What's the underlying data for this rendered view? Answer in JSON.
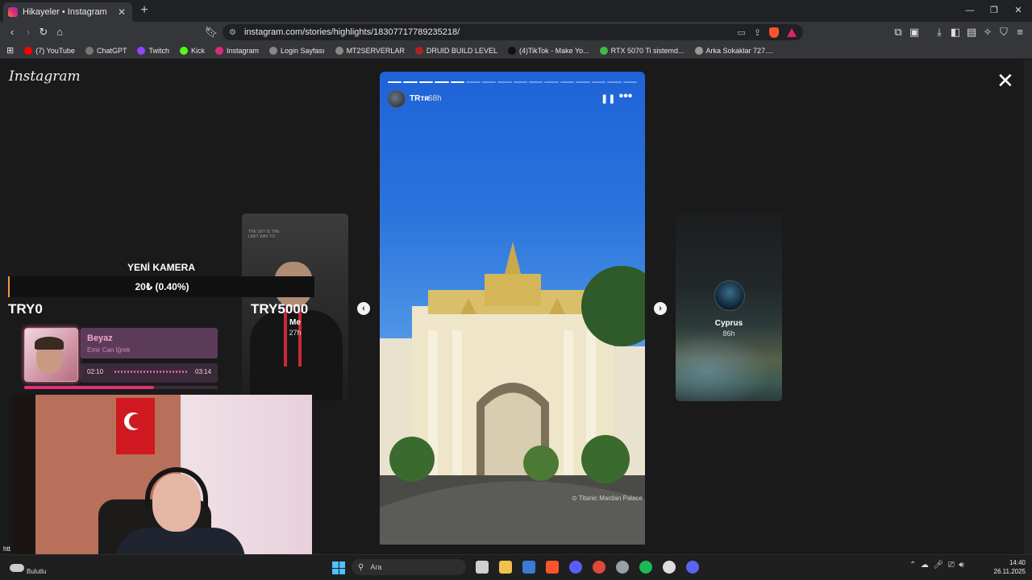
{
  "browser": {
    "tab_title": "Hikayeler • Instagram",
    "url": "instagram.com/stories/highlights/18307717789235218/",
    "bookmarks": [
      {
        "label": "(7) YouTube",
        "color": "#ff0000"
      },
      {
        "label": "ChatGPT",
        "color": "#777777"
      },
      {
        "label": "Twitch",
        "color": "#9146ff"
      },
      {
        "label": "Kick",
        "color": "#53fc18"
      },
      {
        "label": "Instagram",
        "color": "#dd2a7b"
      },
      {
        "label": "Login Sayfası",
        "color": "#888888"
      },
      {
        "label": "MT2SERVERLAR",
        "color": "#888888"
      },
      {
        "label": "DRUID BUILD LEVEL",
        "color": "#b02020"
      },
      {
        "label": "(4)TikTok - Make Yo...",
        "color": "#111111"
      },
      {
        "label": "RTX 5070 Ti sistemd...",
        "color": "#44bb44"
      },
      {
        "label": "Arka Sokaklar 727....",
        "color": "#999999"
      }
    ]
  },
  "instagram": {
    "logo": "Instagram",
    "story": {
      "username": "TRᴛʀ",
      "time": "68h",
      "location": "Titanic Mardan Palace",
      "segments_total": 16,
      "segments_done": 5
    },
    "left_story": {
      "name": "Me",
      "time": "27h"
    },
    "right_story": {
      "name": "Cyprus",
      "time": "86h"
    }
  },
  "stream_overlay": {
    "camera_title": "YENİ KAMERA",
    "donation": "20₺ (0.40%)",
    "counter_left": "TRY0",
    "counter_right": "TRY5000",
    "song": "Beyaz",
    "artist": "Emir Can İğrek",
    "elapsed": "02:10",
    "total": "03:14",
    "progress": 0.67,
    "overlay_text": "htt"
  },
  "taskbar": {
    "weather": "Bulutlu",
    "search_placeholder": "Ara",
    "time": "14:40",
    "date": "26.11.2025",
    "apps": [
      {
        "name": "task-view",
        "color": "#d0d0d0"
      },
      {
        "name": "file-explorer",
        "color": "#f2c14e"
      },
      {
        "name": "store",
        "color": "#3a7bd5"
      },
      {
        "name": "brave",
        "color": "#fb542b"
      },
      {
        "name": "cortana",
        "color": "#5b5bff"
      },
      {
        "name": "app-red",
        "color": "#e04a3a"
      },
      {
        "name": "steam",
        "color": "#9aa0a6"
      },
      {
        "name": "spotify",
        "color": "#1db954"
      },
      {
        "name": "obs",
        "color": "#dddddd"
      },
      {
        "name": "discord",
        "color": "#5865f2"
      }
    ]
  }
}
